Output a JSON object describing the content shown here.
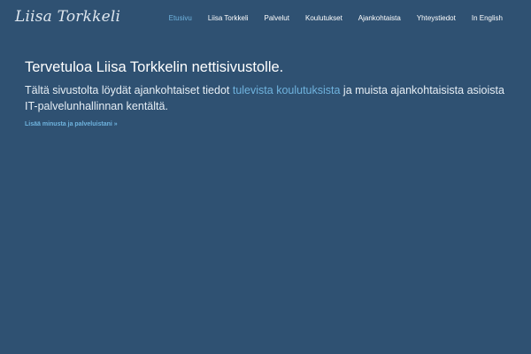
{
  "header": {
    "logo_text": "Liisa Torkkeli",
    "nav": [
      {
        "label": "Etusivu",
        "active": true
      },
      {
        "label": "Liisa Torkkeli",
        "active": false
      },
      {
        "label": "Palvelut",
        "active": false
      },
      {
        "label": "Koulutukset",
        "active": false
      },
      {
        "label": "Ajankohtaista",
        "active": false
      },
      {
        "label": "Yhteystiedot",
        "active": false
      },
      {
        "label": "In English",
        "active": false
      }
    ]
  },
  "hero": {
    "title": "Tervetuloa Liisa Torkkelin nettisivustolle.",
    "text_before": "Tältä sivustolta löydät ajankohtaiset tiedot ",
    "text_link": "tulevista koulutuksista",
    "text_after": " ja muista ajankohtaisista asioista IT-palvelunhallinnan kentältä.",
    "more_link": "Lisää minusta ja palveluistani »"
  },
  "colors": {
    "background": "#2f5172",
    "accent": "#6fb3de",
    "text": "#ffffff"
  }
}
